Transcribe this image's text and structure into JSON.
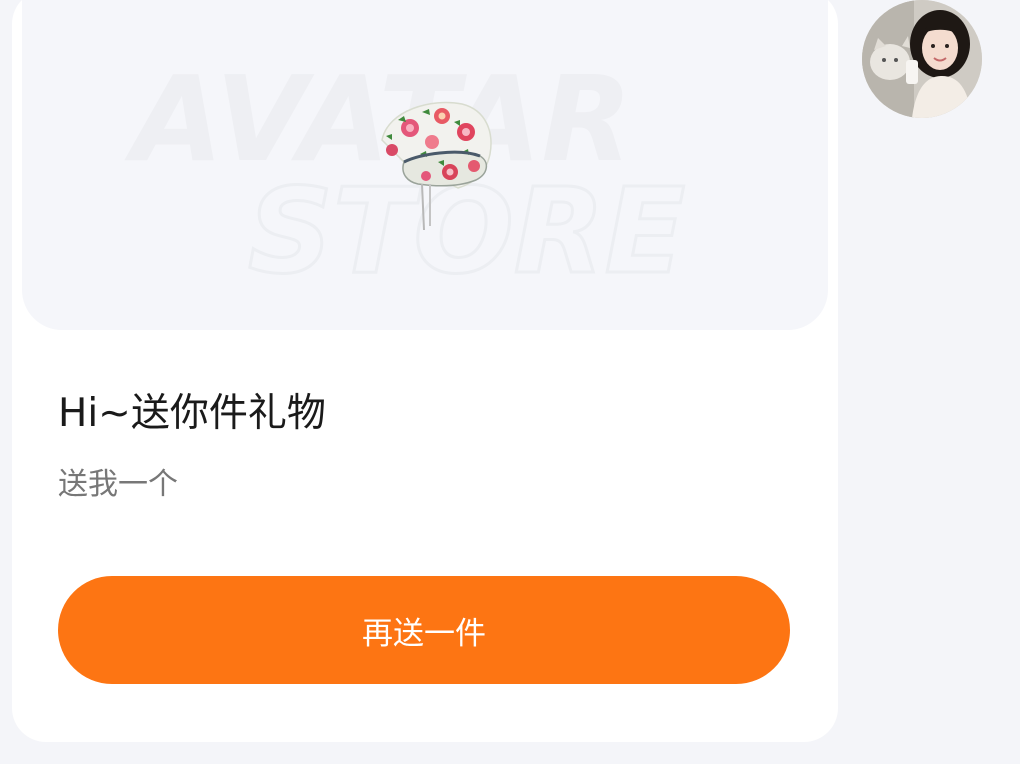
{
  "message": {
    "banner_watermark": {
      "line1": "AVATAR",
      "line2": "STORE"
    },
    "gift_image": "floral-knit-hat",
    "title": "Hi~送你件礼物",
    "subtitle": "送我一个",
    "action_button_label": "再送一件",
    "accent_color": "#fd7513"
  },
  "sender": {
    "avatar": "user-profile-photo"
  }
}
